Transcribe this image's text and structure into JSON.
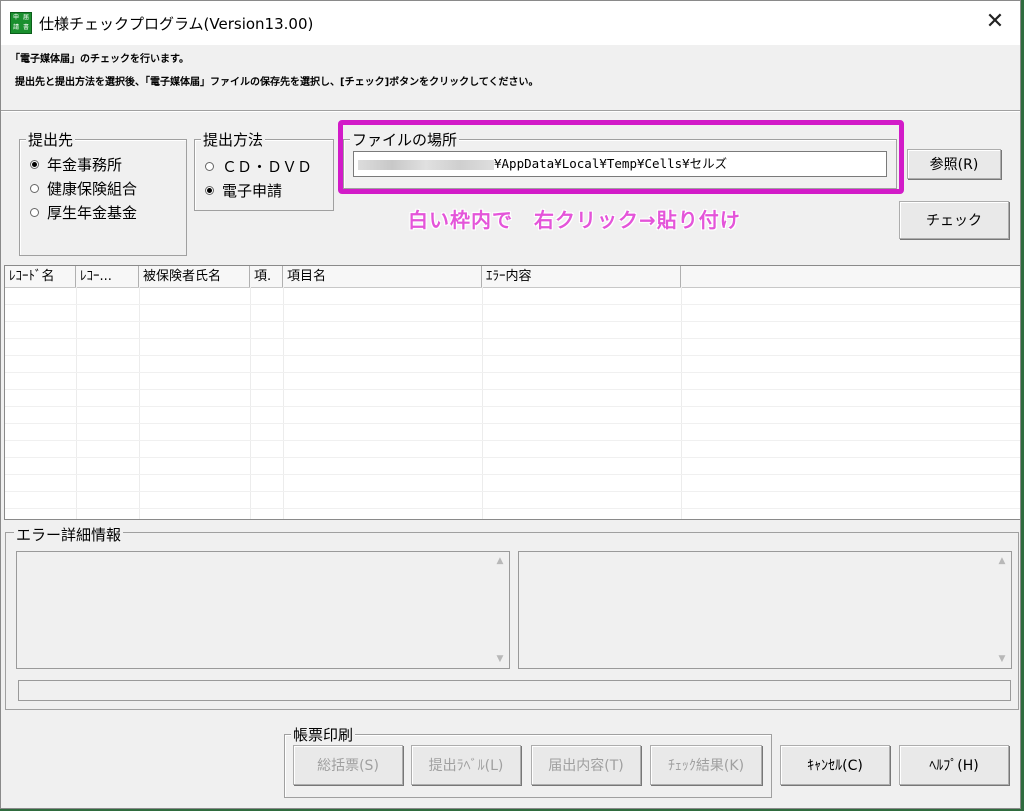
{
  "window": {
    "title": "仕様チェックプログラム(Version13.00)",
    "close_glyph": "✕",
    "icon_chars": [
      "申",
      "届",
      "請",
      "書"
    ]
  },
  "messages": {
    "line1": "「電子媒体届」のチェックを行います。",
    "line2": "提出先と提出方法を選択後、「電子媒体届」ファイルの保存先を選択し、[チェック]ボタンをクリックしてください。"
  },
  "submit_to": {
    "label": "提出先",
    "options": [
      {
        "label": "年金事務所",
        "checked": true
      },
      {
        "label": "健康保険組合",
        "checked": false
      },
      {
        "label": "厚生年金基金",
        "checked": false
      }
    ]
  },
  "method": {
    "label": "提出方法",
    "options": [
      {
        "label": "ＣＤ・ＤＶＤ",
        "checked": false
      },
      {
        "label": "電子申請",
        "checked": true
      }
    ]
  },
  "file_location": {
    "label": "ファイルの場所",
    "value": "¥AppData¥Local¥Temp¥Cells¥セルズ"
  },
  "buttons": {
    "browse": "参照(R)",
    "check": "チェック",
    "cancel": "ｷｬﾝｾﾙ(C)",
    "help": "ﾍﾙﾌﾟ(H)"
  },
  "annotation": {
    "text": "白い枠内で　右クリック→貼り付け",
    "color": "#d21bc8"
  },
  "error_table": {
    "columns": [
      "ﾚｺｰﾄﾞ名",
      "ﾚｺｰ...",
      "被保険者氏名",
      "項.",
      "項目名",
      "ｴﾗｰ内容"
    ],
    "rows": []
  },
  "error_detail": {
    "label": "エラー詳細情報"
  },
  "print_group": {
    "label": "帳票印刷",
    "buttons": [
      "総括票(S)",
      "提出ﾗﾍﾞﾙ(L)",
      "届出内容(T)",
      "ﾁｪｯｸ結果(K)"
    ]
  }
}
